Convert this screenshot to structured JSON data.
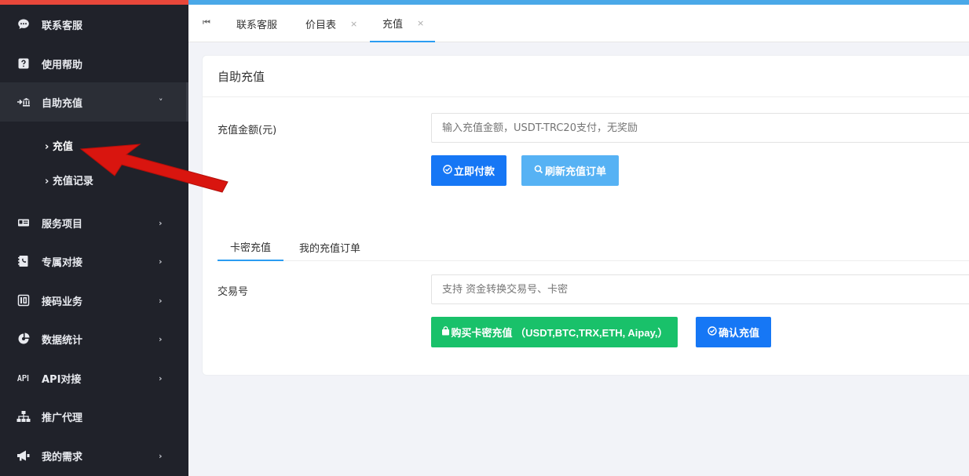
{
  "sidebar": {
    "items": [
      {
        "label": "联系客服",
        "icon": "chat-icon",
        "has_chevron": false
      },
      {
        "label": "使用帮助",
        "icon": "help-icon",
        "has_chevron": false
      },
      {
        "label": "自助充值",
        "icon": "recharge-icon",
        "has_chevron": true,
        "chevron": "˅"
      },
      {
        "label": "服务项目",
        "icon": "id-card-icon",
        "has_chevron": true,
        "chevron": "›"
      },
      {
        "label": "专属对接",
        "icon": "phone-book-icon",
        "has_chevron": true,
        "chevron": "›"
      },
      {
        "label": "接码业务",
        "icon": "sms-code-icon",
        "has_chevron": true,
        "chevron": "›"
      },
      {
        "label": "数据统计",
        "icon": "chart-icon",
        "has_chevron": true,
        "chevron": "›"
      },
      {
        "label": "API对接",
        "icon": "api-icon",
        "has_chevron": true,
        "chevron": "›"
      },
      {
        "label": "推广代理",
        "icon": "sitemap-icon",
        "has_chevron": false
      },
      {
        "label": "我的需求",
        "icon": "megaphone-icon",
        "has_chevron": true,
        "chevron": "›"
      }
    ],
    "sub_items": [
      {
        "label": "充值",
        "prefix": "›"
      },
      {
        "label": "充值记录",
        "prefix": "›"
      }
    ]
  },
  "tabs": [
    {
      "label": "联系客服",
      "closable": false
    },
    {
      "label": "价目表",
      "closable": true,
      "close": "×"
    },
    {
      "label": "充值",
      "closable": true,
      "close": "×"
    }
  ],
  "tab_home_icon": "⏮",
  "card": {
    "title": "自助充值",
    "amount_label": "充值金额(元)",
    "amount_placeholder": "输入充值金额，USDT-TRC20支付，无奖励",
    "pay_button": "立即付款",
    "refresh_button": "刷新充值订单",
    "subtabs": [
      "卡密充值",
      "我的充值订单"
    ],
    "txn_label": "交易号",
    "txn_placeholder": "支持 资金转换交易号、卡密",
    "buy_card_button": "购买卡密充值 （USDT,BTC,TRX,ETH, Aipay,）",
    "confirm_button": "确认充值"
  },
  "colors": {
    "sidebar_bg": "#20222a",
    "accent_blue": "#1677f5",
    "light_blue": "#56b2f4",
    "green": "#19c16a",
    "arrow_red": "#d9150f",
    "top_strip": "#4aa8e8",
    "sidebar_strip": "#e8473a"
  }
}
